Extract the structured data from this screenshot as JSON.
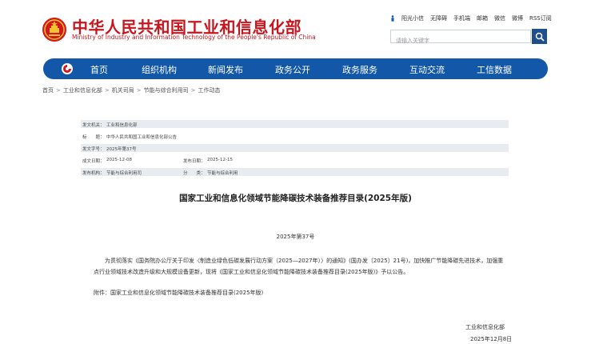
{
  "header": {
    "title": "中华人民共和国工业和信息化部",
    "subtitle": "Ministry of Industry and Information Technology of the People's Republic of China",
    "top_links": [
      "阳光小信",
      "无障碍",
      "手机端",
      "邮箱",
      "微信",
      "微博",
      "RSS订阅"
    ],
    "search_placeholder": "请输入关键字"
  },
  "nav": {
    "items": [
      "首页",
      "组织机构",
      "新闻发布",
      "政务公开",
      "政务服务",
      "互动交流",
      "工信数据"
    ]
  },
  "breadcrumb": [
    "首页",
    "工业和信息化部",
    "机关司局",
    "节能与综合利用司",
    "工作动态"
  ],
  "info": {
    "issuer_label": "发文机关：",
    "issuer": "工业和信息化部",
    "title_label": "标　　题：",
    "title": "中华人民共和国工业和信息化部公告",
    "doc_no_label": "发文字号：",
    "doc_no": "2025年第37号",
    "written_label": "成文日期：",
    "written": "2025-12-08",
    "published_label": "发布日期：",
    "published": "2025-12-15",
    "dept_label": "发布机构：",
    "dept": "节能与综合利用司",
    "category_label": "分　　类：",
    "category": "节能与综合利用"
  },
  "doc": {
    "title": "国家工业和信息化领域节能降碳技术装备推荐目录(2025年版)",
    "number": "2025年第37号",
    "paragraph": "　　为贯彻落实《国务院办公厅关于印发〈制造业绿色低碳发展行动方案（2025—2027年）〉的通知》(国办发〔2025〕21号)，加快推广节能降碳先进技术，加强重点行业领域技术改造升级和大规模设备更新，现将《国家工业和信息化领域节能降碳技术装备推荐目录(2025年版)》予以公告。",
    "attachment": "附件：国家工业和信息化领域节能降碳技术装备推荐目录(2025年版)",
    "signature": "工业和信息化部",
    "date": "2025年12月8日"
  }
}
